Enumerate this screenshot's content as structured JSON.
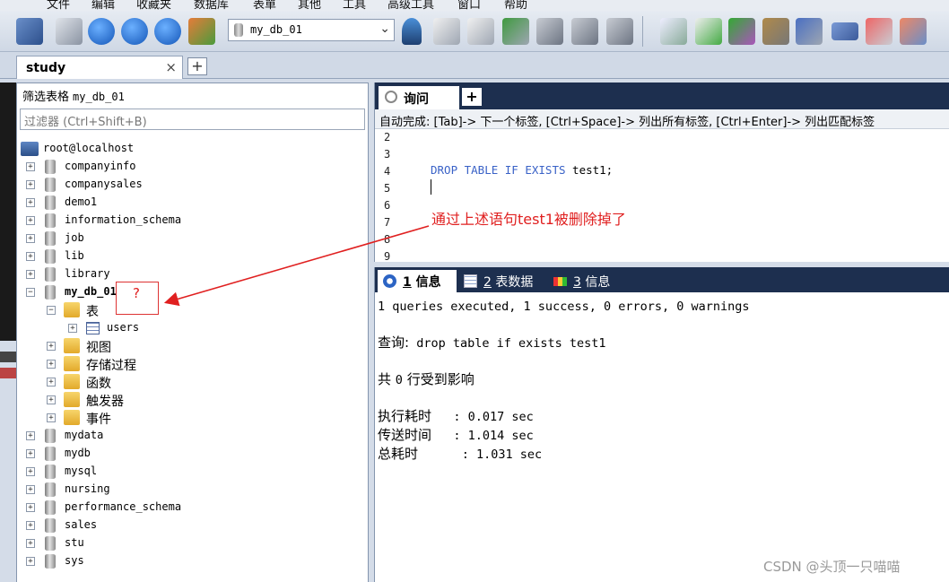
{
  "menu": [
    "文件",
    "编辑",
    "收藏夹",
    "数据库",
    "表單",
    "其他",
    "工具",
    "高级工具",
    "窗口",
    "帮助"
  ],
  "toolbar": {
    "db_select_value": "my_db_01"
  },
  "connection_tab": {
    "label": "study",
    "close": "×",
    "add": "+"
  },
  "filter": {
    "label": "筛选表格",
    "db_name": "my_db_01",
    "placeholder": "过滤器 (Ctrl+Shift+B)"
  },
  "tree": {
    "root": "root@localhost",
    "databases_before": [
      "companyinfo",
      "companysales",
      "demo1",
      "information_schema",
      "job",
      "lib",
      "library"
    ],
    "selected_db": "my_db_01",
    "folder_tables": "表",
    "table_users": "users",
    "folders": [
      "视图",
      "存储过程",
      "函数",
      "触发器",
      "事件"
    ],
    "databases_after": [
      "mydata",
      "mydb",
      "mysql",
      "nursing",
      "performance_schema",
      "sales",
      "stu",
      "sys"
    ]
  },
  "annotation": {
    "question_mark": "?",
    "note": "通过上述语句test1被删除掉了"
  },
  "query": {
    "tab_label": "询问",
    "tab_add": "+",
    "autocomplete": "自动完成: [Tab]-> 下一个标签, [Ctrl+Space]-> 列出所有标签, [Ctrl+Enter]-> 列出匹配标签",
    "line_numbers": [
      "2",
      "3",
      "4",
      "5",
      "6",
      "7",
      "8",
      "9"
    ],
    "sql_kw": "DROP TABLE IF EXISTS",
    "sql_rest": " test1;"
  },
  "results": {
    "tabs": [
      {
        "num": "1",
        "label": "信息"
      },
      {
        "num": "2",
        "label": "表数据"
      },
      {
        "num": "3",
        "label": "信息"
      }
    ],
    "line1": "1 queries executed, 1 success, 0 errors, 0 warnings",
    "line2_label": "查询:",
    "line2_sql": " drop table if exists test1",
    "line3_a": "共 ",
    "line3_num": "0",
    "line3_b": " 行受到影响",
    "exec_label": "执行耗时",
    "exec_value": "   : 0.017 sec",
    "transfer_label": "传送时间",
    "transfer_value": "   : 1.014 sec",
    "total_label": "总耗时",
    "total_value": "      : 1.031 sec"
  },
  "watermark": "CSDN @头顶一只喵喵",
  "colors": {
    "accent_dark": "#1d2f4f",
    "annotation_red": "#e02020",
    "sql_keyword": "#3a62c7"
  }
}
